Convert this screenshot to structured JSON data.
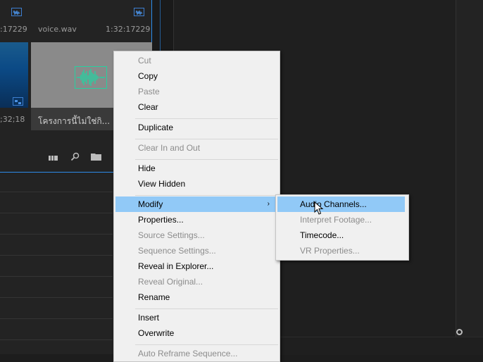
{
  "project_panel": {
    "tiles": [
      {
        "name": "",
        "duration": ":17229"
      },
      {
        "name": "voice.wav",
        "duration": "1:32:17229"
      },
      {
        "name": "",
        "duration": ";32;18"
      },
      {
        "name": "โครงการนี้ไม่ใช่กิ..."
      }
    ]
  },
  "icons": {
    "audio_badge": "audio-badge-icon",
    "video_badge": "video-badge-icon",
    "waveform": "audio-waveform-icon",
    "list_view": "list-view-icon",
    "search": "search-icon",
    "folder": "folder-icon"
  },
  "context_menu": {
    "items": [
      {
        "label": "Cut",
        "enabled": false
      },
      {
        "label": "Copy",
        "enabled": true
      },
      {
        "label": "Paste",
        "enabled": false
      },
      {
        "label": "Clear",
        "enabled": true
      },
      {
        "label": "Duplicate",
        "enabled": true
      },
      {
        "label": "Clear In and Out",
        "enabled": false
      },
      {
        "label": "Hide",
        "enabled": true
      },
      {
        "label": "View Hidden",
        "enabled": true
      },
      {
        "label": "Modify",
        "enabled": true,
        "highlighted": true,
        "has_submenu": true
      },
      {
        "label": "Properties...",
        "enabled": true
      },
      {
        "label": "Source Settings...",
        "enabled": false
      },
      {
        "label": "Sequence Settings...",
        "enabled": false
      },
      {
        "label": "Reveal in Explorer...",
        "enabled": true
      },
      {
        "label": "Reveal Original...",
        "enabled": false
      },
      {
        "label": "Rename",
        "enabled": true
      },
      {
        "label": "Insert",
        "enabled": true
      },
      {
        "label": "Overwrite",
        "enabled": true
      },
      {
        "label": "Auto Reframe Sequence...",
        "enabled": false
      }
    ],
    "submenu_arrow": "›"
  },
  "modify_submenu": {
    "items": [
      {
        "label": "Audio Channels...",
        "enabled": true,
        "highlighted": true
      },
      {
        "label": "Interpret Footage...",
        "enabled": false
      },
      {
        "label": "Timecode...",
        "enabled": true
      },
      {
        "label": "VR Properties...",
        "enabled": false
      }
    ]
  },
  "colors": {
    "menu_bg": "#f0f0f0",
    "menu_highlight": "#91c9f7",
    "panel_focus_border": "#2d8ceb",
    "waveform": "#27d0a0"
  }
}
